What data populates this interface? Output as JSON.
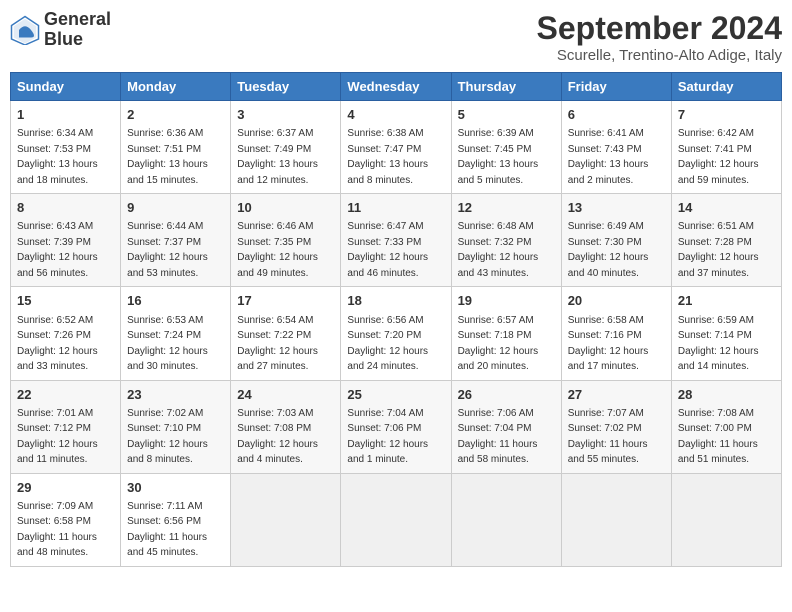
{
  "header": {
    "logo_line1": "General",
    "logo_line2": "Blue",
    "month_year": "September 2024",
    "location": "Scurelle, Trentino-Alto Adige, Italy"
  },
  "weekdays": [
    "Sunday",
    "Monday",
    "Tuesday",
    "Wednesday",
    "Thursday",
    "Friday",
    "Saturday"
  ],
  "weeks": [
    [
      {
        "day": "1",
        "sunrise": "6:34 AM",
        "sunset": "7:53 PM",
        "daylight": "13 hours and 18 minutes."
      },
      {
        "day": "2",
        "sunrise": "6:36 AM",
        "sunset": "7:51 PM",
        "daylight": "13 hours and 15 minutes."
      },
      {
        "day": "3",
        "sunrise": "6:37 AM",
        "sunset": "7:49 PM",
        "daylight": "13 hours and 12 minutes."
      },
      {
        "day": "4",
        "sunrise": "6:38 AM",
        "sunset": "7:47 PM",
        "daylight": "13 hours and 8 minutes."
      },
      {
        "day": "5",
        "sunrise": "6:39 AM",
        "sunset": "7:45 PM",
        "daylight": "13 hours and 5 minutes."
      },
      {
        "day": "6",
        "sunrise": "6:41 AM",
        "sunset": "7:43 PM",
        "daylight": "13 hours and 2 minutes."
      },
      {
        "day": "7",
        "sunrise": "6:42 AM",
        "sunset": "7:41 PM",
        "daylight": "12 hours and 59 minutes."
      }
    ],
    [
      {
        "day": "8",
        "sunrise": "6:43 AM",
        "sunset": "7:39 PM",
        "daylight": "12 hours and 56 minutes."
      },
      {
        "day": "9",
        "sunrise": "6:44 AM",
        "sunset": "7:37 PM",
        "daylight": "12 hours and 53 minutes."
      },
      {
        "day": "10",
        "sunrise": "6:46 AM",
        "sunset": "7:35 PM",
        "daylight": "12 hours and 49 minutes."
      },
      {
        "day": "11",
        "sunrise": "6:47 AM",
        "sunset": "7:33 PM",
        "daylight": "12 hours and 46 minutes."
      },
      {
        "day": "12",
        "sunrise": "6:48 AM",
        "sunset": "7:32 PM",
        "daylight": "12 hours and 43 minutes."
      },
      {
        "day": "13",
        "sunrise": "6:49 AM",
        "sunset": "7:30 PM",
        "daylight": "12 hours and 40 minutes."
      },
      {
        "day": "14",
        "sunrise": "6:51 AM",
        "sunset": "7:28 PM",
        "daylight": "12 hours and 37 minutes."
      }
    ],
    [
      {
        "day": "15",
        "sunrise": "6:52 AM",
        "sunset": "7:26 PM",
        "daylight": "12 hours and 33 minutes."
      },
      {
        "day": "16",
        "sunrise": "6:53 AM",
        "sunset": "7:24 PM",
        "daylight": "12 hours and 30 minutes."
      },
      {
        "day": "17",
        "sunrise": "6:54 AM",
        "sunset": "7:22 PM",
        "daylight": "12 hours and 27 minutes."
      },
      {
        "day": "18",
        "sunrise": "6:56 AM",
        "sunset": "7:20 PM",
        "daylight": "12 hours and 24 minutes."
      },
      {
        "day": "19",
        "sunrise": "6:57 AM",
        "sunset": "7:18 PM",
        "daylight": "12 hours and 20 minutes."
      },
      {
        "day": "20",
        "sunrise": "6:58 AM",
        "sunset": "7:16 PM",
        "daylight": "12 hours and 17 minutes."
      },
      {
        "day": "21",
        "sunrise": "6:59 AM",
        "sunset": "7:14 PM",
        "daylight": "12 hours and 14 minutes."
      }
    ],
    [
      {
        "day": "22",
        "sunrise": "7:01 AM",
        "sunset": "7:12 PM",
        "daylight": "12 hours and 11 minutes."
      },
      {
        "day": "23",
        "sunrise": "7:02 AM",
        "sunset": "7:10 PM",
        "daylight": "12 hours and 8 minutes."
      },
      {
        "day": "24",
        "sunrise": "7:03 AM",
        "sunset": "7:08 PM",
        "daylight": "12 hours and 4 minutes."
      },
      {
        "day": "25",
        "sunrise": "7:04 AM",
        "sunset": "7:06 PM",
        "daylight": "12 hours and 1 minute."
      },
      {
        "day": "26",
        "sunrise": "7:06 AM",
        "sunset": "7:04 PM",
        "daylight": "11 hours and 58 minutes."
      },
      {
        "day": "27",
        "sunrise": "7:07 AM",
        "sunset": "7:02 PM",
        "daylight": "11 hours and 55 minutes."
      },
      {
        "day": "28",
        "sunrise": "7:08 AM",
        "sunset": "7:00 PM",
        "daylight": "11 hours and 51 minutes."
      }
    ],
    [
      {
        "day": "29",
        "sunrise": "7:09 AM",
        "sunset": "6:58 PM",
        "daylight": "11 hours and 48 minutes."
      },
      {
        "day": "30",
        "sunrise": "7:11 AM",
        "sunset": "6:56 PM",
        "daylight": "11 hours and 45 minutes."
      },
      null,
      null,
      null,
      null,
      null
    ]
  ]
}
